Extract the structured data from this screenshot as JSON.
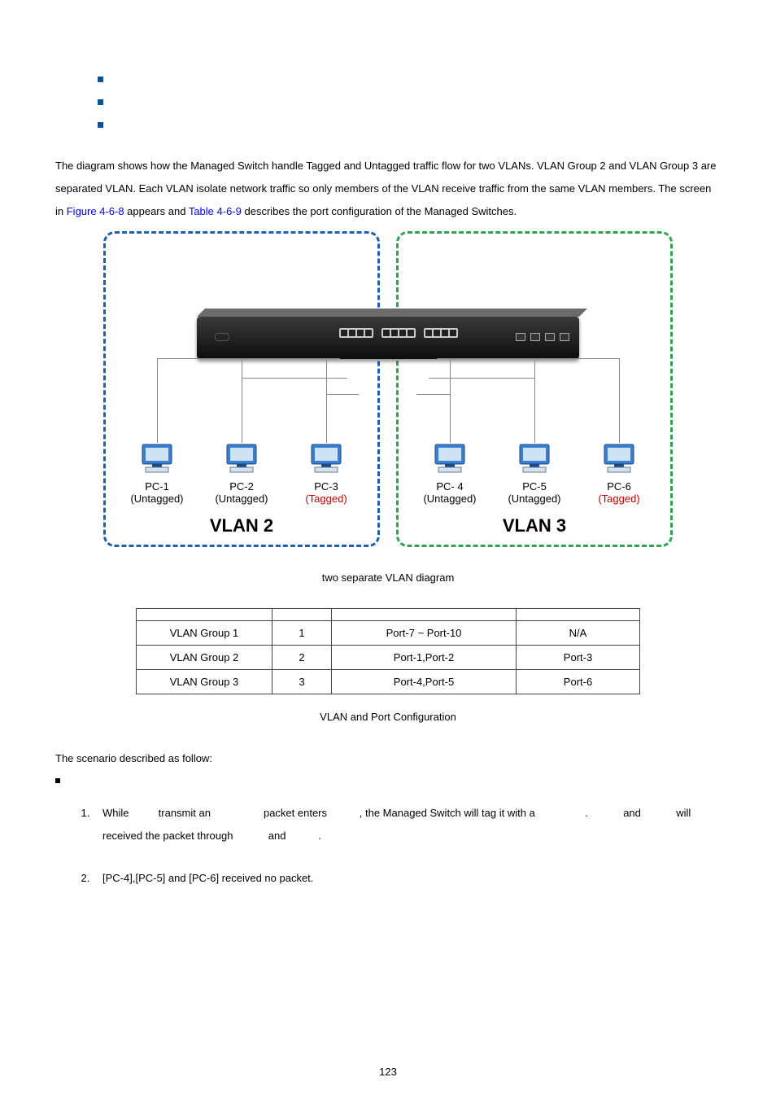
{
  "bullets": [
    "",
    "",
    ""
  ],
  "para": {
    "t1": "The diagram shows how the Managed Switch handle Tagged and Untagged traffic flow for two VLANs. VLAN Group 2 and VLAN Group 3 are separated VLAN. Each VLAN isolate network traffic so only members of the VLAN receive traffic from the same VLAN members. The screen in ",
    "link1": "Figure 4-6-8",
    "t2": " appears and ",
    "link2": "Table 4-6-9",
    "t3": " describes the port configuration of the Managed Switches."
  },
  "diagram": {
    "pcs_left": [
      {
        "name": "PC-1",
        "tag": "(Untagged)",
        "red": false
      },
      {
        "name": "PC-2",
        "tag": "(Untagged)",
        "red": false
      },
      {
        "name": "PC-3",
        "tag": "(Tagged)",
        "red": true
      }
    ],
    "pcs_right": [
      {
        "name": "PC- 4",
        "tag": "(Untagged)",
        "red": false
      },
      {
        "name": "PC-5",
        "tag": "(Untagged)",
        "red": false
      },
      {
        "name": "PC-6",
        "tag": "(Tagged)",
        "red": true
      }
    ],
    "vlan_left": "VLAN 2",
    "vlan_right": "VLAN 3"
  },
  "fig_caption": " two separate VLAN diagram",
  "table": {
    "headers": [
      "",
      "",
      "",
      ""
    ],
    "rows": [
      [
        "VLAN Group 1",
        "1",
        "Port-7 ~ Port-10",
        "N/A"
      ],
      [
        "VLAN Group 2",
        "2",
        "Port-1,Port-2",
        "Port-3"
      ],
      [
        "VLAN Group 3",
        "3",
        "Port-4,Port-5",
        "Port-6"
      ]
    ]
  },
  "tbl_caption": " VLAN and Port Configuration",
  "scenario_intro": "The scenario described as follow:",
  "numlist": {
    "n1": {
      "a": "While ",
      "b": " transmit an ",
      "c": " packet enters ",
      "d": ", the Managed Switch will tag it with a ",
      "e": ". ",
      "f": " and ",
      "g": " will received the packet through ",
      "h": " and ",
      "i": "."
    },
    "n2": "[PC-4],[PC-5] and [PC-6] received no packet."
  },
  "pagenum": "123"
}
